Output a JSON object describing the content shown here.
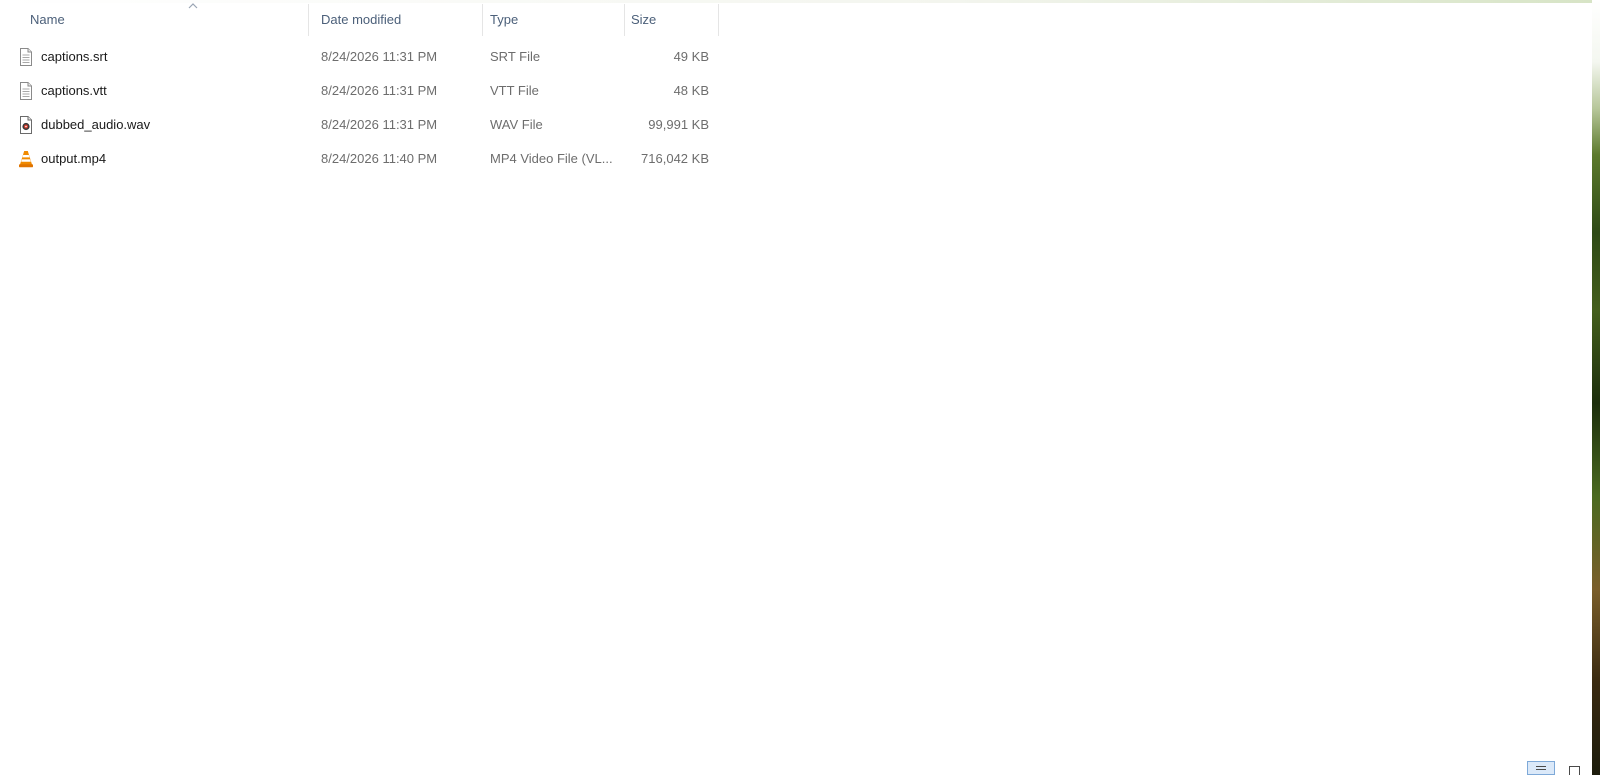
{
  "columns": {
    "name": "Name",
    "date": "Date modified",
    "type": "Type",
    "size": "Size"
  },
  "files": [
    {
      "name": "captions.srt",
      "date": "8/24/2026 11:31 PM",
      "type": "SRT File",
      "size": "49 KB",
      "icon": "text-file-icon"
    },
    {
      "name": "captions.vtt",
      "date": "8/24/2026 11:31 PM",
      "type": "VTT File",
      "size": "48 KB",
      "icon": "text-file-icon"
    },
    {
      "name": "dubbed_audio.wav",
      "date": "8/24/2026 11:31 PM",
      "type": "WAV File",
      "size": "99,991 KB",
      "icon": "audio-file-icon"
    },
    {
      "name": "output.mp4",
      "date": "8/24/2026 11:40 PM",
      "type": "MP4 Video File (VL...",
      "size": "716,042 KB",
      "icon": "vlc-cone-icon"
    }
  ],
  "colors": {
    "header_text": "#4c607a",
    "secondary_text": "#6d6d6d",
    "vlc_orange": "#f08a00",
    "selected_toggle": "#dbe9f9"
  }
}
